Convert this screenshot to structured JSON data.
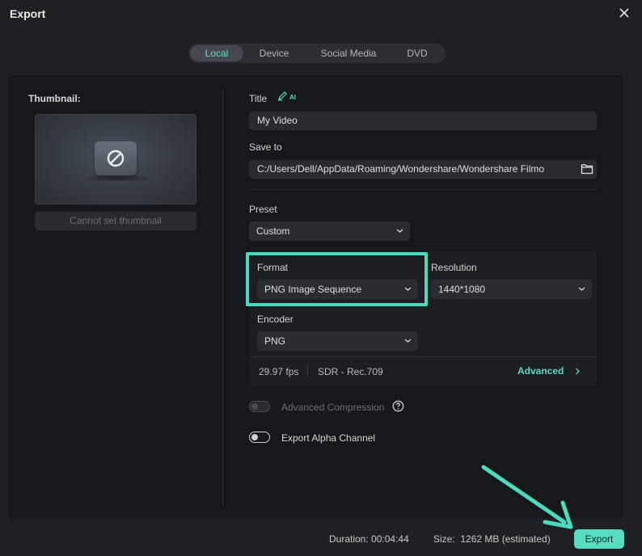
{
  "window": {
    "title": "Export",
    "close_icon": "close-icon"
  },
  "tabs": [
    {
      "label": "Local",
      "active": true
    },
    {
      "label": "Device",
      "active": false
    },
    {
      "label": "Social Media",
      "active": false
    },
    {
      "label": "DVD",
      "active": false
    }
  ],
  "thumbnail": {
    "label": "Thumbnail:",
    "icon": "no-symbol-icon",
    "button_label": "Cannot set thumbnail"
  },
  "title_field": {
    "label": "Title",
    "ai_badge": "AI",
    "value": "My Video"
  },
  "save_to": {
    "label": "Save to",
    "value": "C:/Users/Dell/AppData/Roaming/Wondershare/Wondershare Filmo",
    "icon": "folder-icon"
  },
  "preset": {
    "label": "Preset",
    "value": "Custom"
  },
  "format": {
    "label": "Format",
    "value": "PNG Image Sequence"
  },
  "resolution": {
    "label": "Resolution",
    "value": "1440*1080"
  },
  "encoder": {
    "label": "Encoder",
    "value": "PNG"
  },
  "info": {
    "fps": "29.97 fps",
    "color": "SDR - Rec.709",
    "advanced_label": "Advanced"
  },
  "options": {
    "advanced_compression": {
      "label": "Advanced Compression",
      "enabled": false,
      "disabled": true
    },
    "export_alpha": {
      "label": "Export Alpha Channel",
      "enabled": false
    }
  },
  "footer": {
    "duration": "Duration: 00:04:44",
    "size": "Size:  1262 MB (estimated)",
    "export_label": "Export"
  },
  "colors": {
    "accent": "#56dcbf",
    "highlight": "#4dd9bb",
    "panel": "#17181b"
  }
}
